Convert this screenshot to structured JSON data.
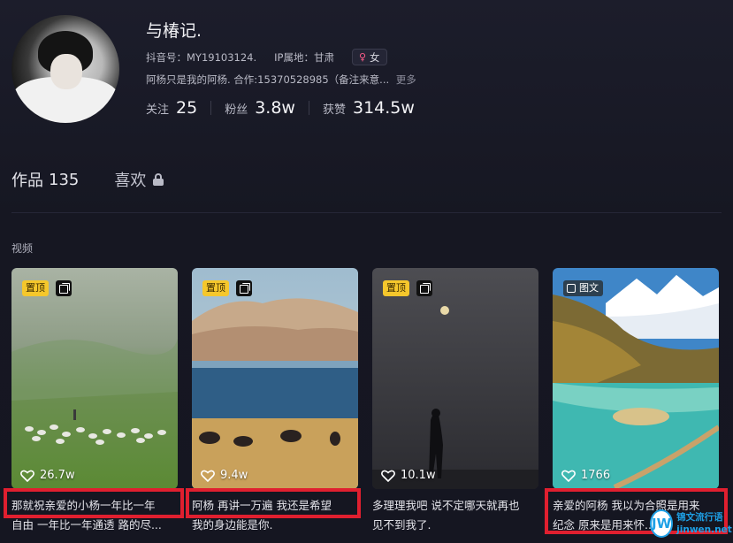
{
  "profile": {
    "nickname": "与椿记.",
    "douyin_id": "抖音号：MY19103124.",
    "ip_location": "IP属地：甘肃",
    "gender": "女",
    "bio": "阿杨只是我的阿杨. 合作:15370528985（备注来意...",
    "bio_more": "更多",
    "stats": [
      {
        "label": "关注",
        "value": "25"
      },
      {
        "label": "粉丝",
        "value": "3.8w"
      },
      {
        "label": "获赞",
        "value": "314.5w"
      }
    ]
  },
  "tabs": {
    "works_label": "作品",
    "works_count": "135",
    "likes_label": "喜欢"
  },
  "section_label": "视频",
  "cards": [
    {
      "pin": "置顶",
      "likes": "26.7w",
      "caption_l1": "那就祝亲爱的小杨一年比一年",
      "caption_l2": "自由 一年比一年通透 路的尽..."
    },
    {
      "pin": "置顶",
      "likes": "9.4w",
      "caption_l1": "阿杨 再讲一万遍 我还是希望",
      "caption_l2": "我的身边能是你."
    },
    {
      "pin": "置顶",
      "likes": "10.1w",
      "caption_l1": "多理理我吧 说不定哪天就再也",
      "caption_l2": "见不到我了."
    },
    {
      "tag": "图文",
      "likes": "1766",
      "caption_l1": "亲爱的阿杨 我以为合照是用来",
      "caption_l2": "纪念 原来是用来怀..."
    }
  ],
  "watermark": {
    "logo": "JW",
    "line1": "锦文流行语",
    "line2": "jinwen.net"
  },
  "colors": {
    "background": "#161722",
    "highlight": "#e01f2f",
    "pin": "#f5c72c",
    "watermark": "#1ea0e6"
  }
}
